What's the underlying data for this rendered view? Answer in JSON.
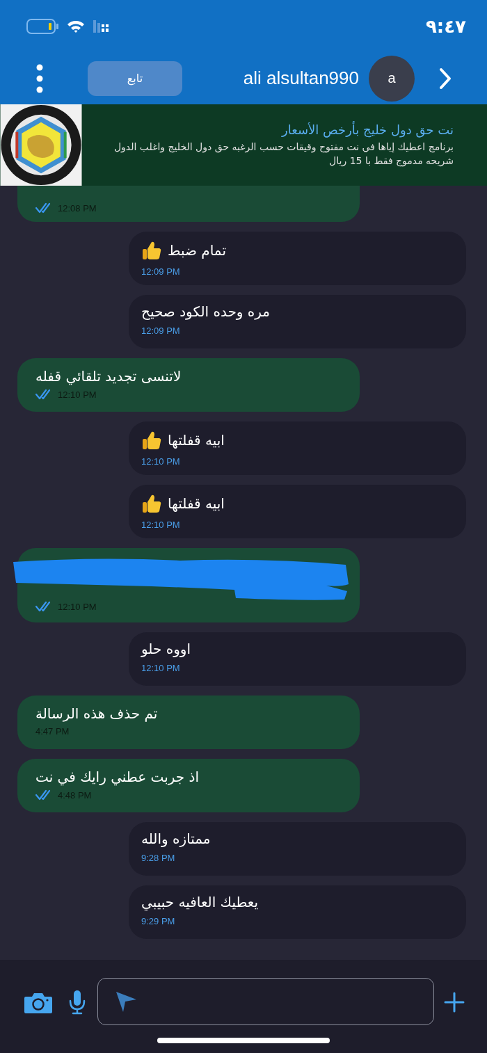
{
  "status_bar": {
    "time": "٩:٤٧"
  },
  "header": {
    "follow_button": "تابع",
    "contact_name": "ali alsultan990",
    "avatar_letter": "a"
  },
  "ad_banner": {
    "title": "نت حق دول خليج بأرخص الأسعار",
    "text": "برنامج اعطيك إياها في نت مفتوح وقيقات حسب الرغبه حق دول الخليج واغلب الدول شريحه مدموج فقط با 15 ريال"
  },
  "messages": [
    {
      "kind": "sent",
      "time": "12:08 PM",
      "read": true,
      "cut_off": true
    },
    {
      "kind": "received",
      "text": "تمام ضبط",
      "thumbs_up": true,
      "time": "12:09 PM"
    },
    {
      "kind": "received",
      "text": "مره وحده الكود صحيح",
      "thumbs_up": false,
      "time": "12:09 PM"
    },
    {
      "kind": "sent",
      "text": "لاتنسى تجديد تلقائي قفله",
      "time": "12:10 PM",
      "read": true
    },
    {
      "kind": "received",
      "text": "ابيه قفلتها",
      "thumbs_up": true,
      "time": "12:10 PM"
    },
    {
      "kind": "received",
      "text": "ابيه قفلتها",
      "thumbs_up": true,
      "time": "12:10 PM"
    },
    {
      "kind": "sent",
      "redacted": true,
      "time": "12:10 PM",
      "read": true
    },
    {
      "kind": "received",
      "text": "اووه حلو",
      "thumbs_up": false,
      "time": "12:10 PM"
    },
    {
      "kind": "sent",
      "text": "تم حذف هذه الرسالة",
      "time": "4:47 PM",
      "read": false
    },
    {
      "kind": "sent",
      "text": "اذ جربت عطني رايك في نت",
      "time": "4:48 PM",
      "read": true
    },
    {
      "kind": "received",
      "text": "ممتازه والله",
      "thumbs_up": false,
      "time": "9:28 PM"
    },
    {
      "kind": "received",
      "text": "يعطيك العافيه حبيبي",
      "thumbs_up": false,
      "time": "9:29 PM"
    }
  ]
}
